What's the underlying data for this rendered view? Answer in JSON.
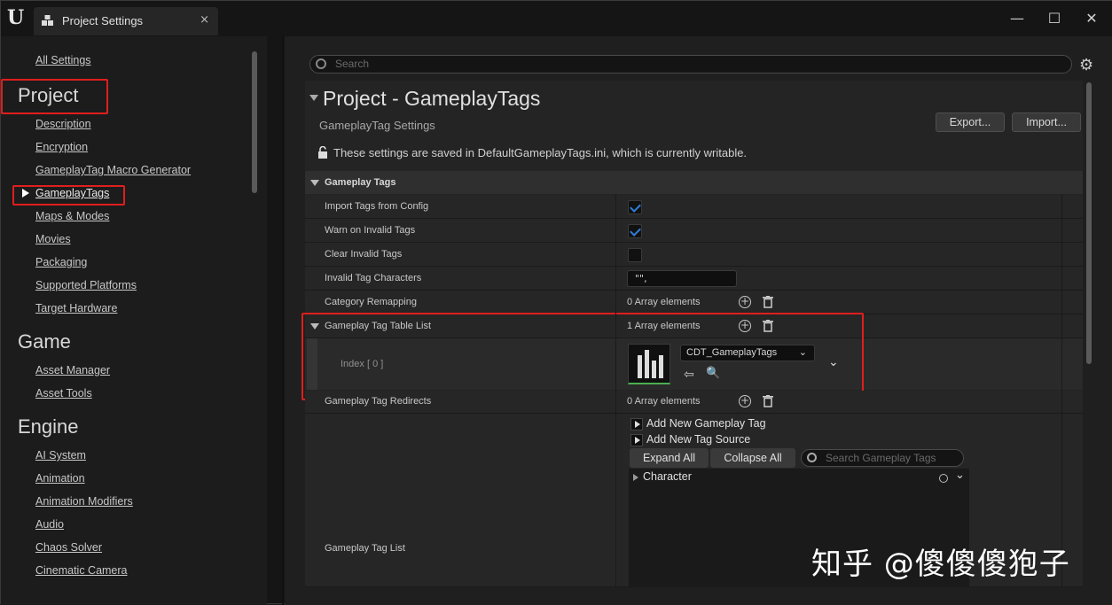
{
  "window": {
    "tab_title": "Project Settings",
    "tab_close": "×",
    "minimize": "—",
    "maximize": "☐",
    "close": "✕"
  },
  "sidebar": {
    "all_settings": "All Settings",
    "sections": [
      {
        "heading": "Project",
        "items": [
          "Description",
          "Encryption",
          "GameplayTag Macro Generator",
          "GameplayTags",
          "Maps & Modes",
          "Movies",
          "Packaging",
          "Supported Platforms",
          "Target Hardware"
        ]
      },
      {
        "heading": "Game",
        "items": [
          "Asset Manager",
          "Asset Tools"
        ]
      },
      {
        "heading": "Engine",
        "items": [
          "AI System",
          "Animation",
          "Animation Modifiers",
          "Audio",
          "Chaos Solver",
          "Cinematic Camera"
        ]
      }
    ],
    "selected_item": "GameplayTags"
  },
  "search": {
    "placeholder": "Search"
  },
  "main": {
    "title": "Project - GameplayTags",
    "subtitle": "GameplayTag Settings",
    "export_label": "Export...",
    "import_label": "Import...",
    "notice": "These settings are saved in DefaultGameplayTags.ini, which is currently writable.",
    "section_label": "Gameplay Tags",
    "rows": {
      "import_tags": {
        "label": "Import Tags from Config",
        "checked": true
      },
      "warn_invalid": {
        "label": "Warn on Invalid Tags",
        "checked": true
      },
      "clear_invalid": {
        "label": "Clear Invalid Tags",
        "checked": false
      },
      "invalid_chars": {
        "label": "Invalid Tag Characters",
        "value": "\"\","
      },
      "category_remap": {
        "label": "Category Remapping",
        "count": "0 Array elements"
      },
      "table_list": {
        "label": "Gameplay Tag Table List",
        "count": "1 Array elements"
      },
      "index0": {
        "label": "Index [ 0 ]",
        "asset": "CDT_GameplayTags"
      },
      "redirects": {
        "label": "Gameplay Tag Redirects",
        "count": "0 Array elements"
      },
      "tag_list": {
        "label": "Gameplay Tag List"
      }
    },
    "tag_panel": {
      "add_tag": "Add New Gameplay Tag",
      "add_source": "Add New Tag Source",
      "expand_all": "Expand All",
      "collapse_all": "Collapse All",
      "search_placeholder": "Search Gameplay Tags",
      "tree_items": [
        "Character"
      ]
    }
  },
  "watermark": "知乎 @傻傻傻狍子",
  "colors": {
    "highlight_box": "#e01e1e",
    "checkbox_check": "#2f7ed8"
  }
}
